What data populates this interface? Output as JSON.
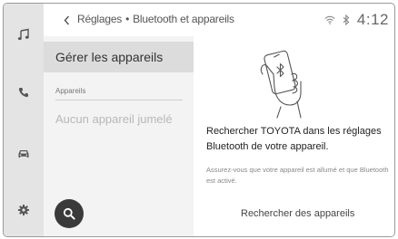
{
  "rail": {
    "items": [
      {
        "name": "music",
        "icon": "music-note-icon"
      },
      {
        "name": "phone",
        "icon": "phone-icon"
      },
      {
        "name": "vehicle",
        "icon": "car-icon"
      },
      {
        "name": "settings",
        "icon": "gear-icon"
      }
    ]
  },
  "header": {
    "back_icon": "chevron-left-icon",
    "crumb_parent": "Réglages",
    "crumb_separator": "•",
    "crumb_current": "Bluetooth et appareils",
    "time": "4:12",
    "status_icons": [
      "wifi-icon",
      "bluetooth-icon"
    ]
  },
  "panel": {
    "selected_item": "Gérer les appareils",
    "section_label": "Appareils",
    "empty_text": "Aucun appareil jumelé",
    "search_fab_icon": "search-icon"
  },
  "content": {
    "illustration": "phone-in-hand-bluetooth-icon",
    "instruction": "Rechercher TOYOTA dans les réglages Bluetooth de votre appareil.",
    "note": "Assurez-vous que votre appareil est allumé et que Bluetooth est activé.",
    "search_button": "Rechercher des appareils"
  },
  "colors": {
    "rail": "#e4e4e4",
    "panel": "#f3f3f3",
    "selected": "#dcdcdc",
    "fab": "#3a3a3a"
  }
}
